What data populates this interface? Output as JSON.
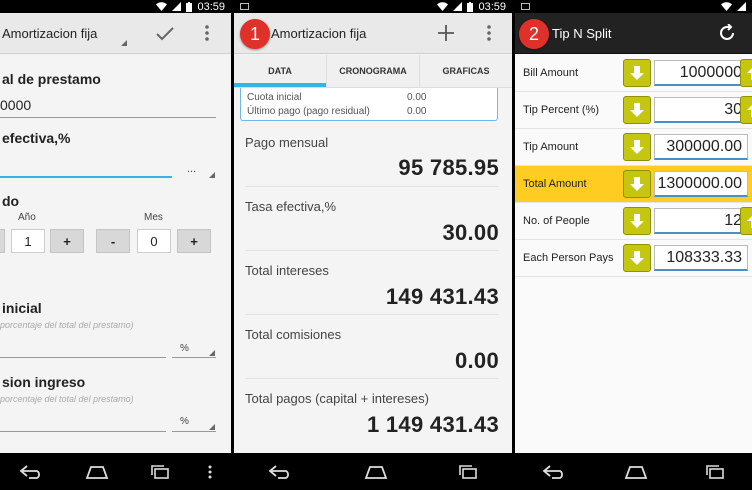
{
  "status": {
    "time": "03:59"
  },
  "panel1": {
    "title": "Amortizacion fija",
    "loan_label": "al de prestamo",
    "loan_value": "0000",
    "rate_label": "efectiva,%",
    "rate_more": "...",
    "term_label": "do",
    "year_label": "Año",
    "year_value": "1",
    "month_label": "Mes",
    "month_value": "0",
    "minus": "-",
    "plus": "+",
    "down_label": "inicial",
    "down_hint": "porcentaje del total del prestamo)",
    "commission_label": "sion ingreso",
    "commission_hint": "porcentaje del total del prestamo)",
    "percent": "%"
  },
  "panel2": {
    "badge": "1",
    "title": "Amortizacion fija",
    "tabs": [
      "DATA",
      "CRONOGRAMA",
      "GRAFICAS"
    ],
    "info": [
      {
        "k": "Cuota inicial",
        "v": "0.00"
      },
      {
        "k": "Último pago (pago residual)",
        "v": "0.00"
      }
    ],
    "results": [
      {
        "label": "Pago mensual",
        "value": "95 785.95"
      },
      {
        "label": "Tasa efectiva,%",
        "value": "30.00"
      },
      {
        "label": "Total intereses",
        "value": "149 431.43"
      },
      {
        "label": "Total comisiones",
        "value": "0.00"
      },
      {
        "label": "Total pagos (capital + intereses)",
        "value": "1 149 431.43"
      }
    ]
  },
  "panel3": {
    "badge": "2",
    "title": "Tip N Split",
    "rows": [
      {
        "label": "Bill Amount",
        "value": "1000000"
      },
      {
        "label": "Tip Percent (%)",
        "value": "30"
      },
      {
        "label": "Tip Amount",
        "value": "300000.00"
      },
      {
        "label": "Total Amount",
        "value": "1300000.00"
      },
      {
        "label": "No. of People",
        "value": "12"
      },
      {
        "label": "Each Person Pays",
        "value": "108333.33"
      }
    ]
  },
  "colors": {
    "accent_blue": "#33b5e5",
    "badge_red": "#e0302a",
    "highlight_yellow": "#ffcc22",
    "arrow_olive": "#c5c60f"
  },
  "icons": [
    "wifi-icon",
    "signal-icon",
    "battery-icon",
    "check-icon",
    "overflow-menu-icon",
    "add-icon",
    "refresh-icon",
    "back-icon",
    "home-icon",
    "recents-icon",
    "arrow-down-icon",
    "arrow-up-icon"
  ]
}
